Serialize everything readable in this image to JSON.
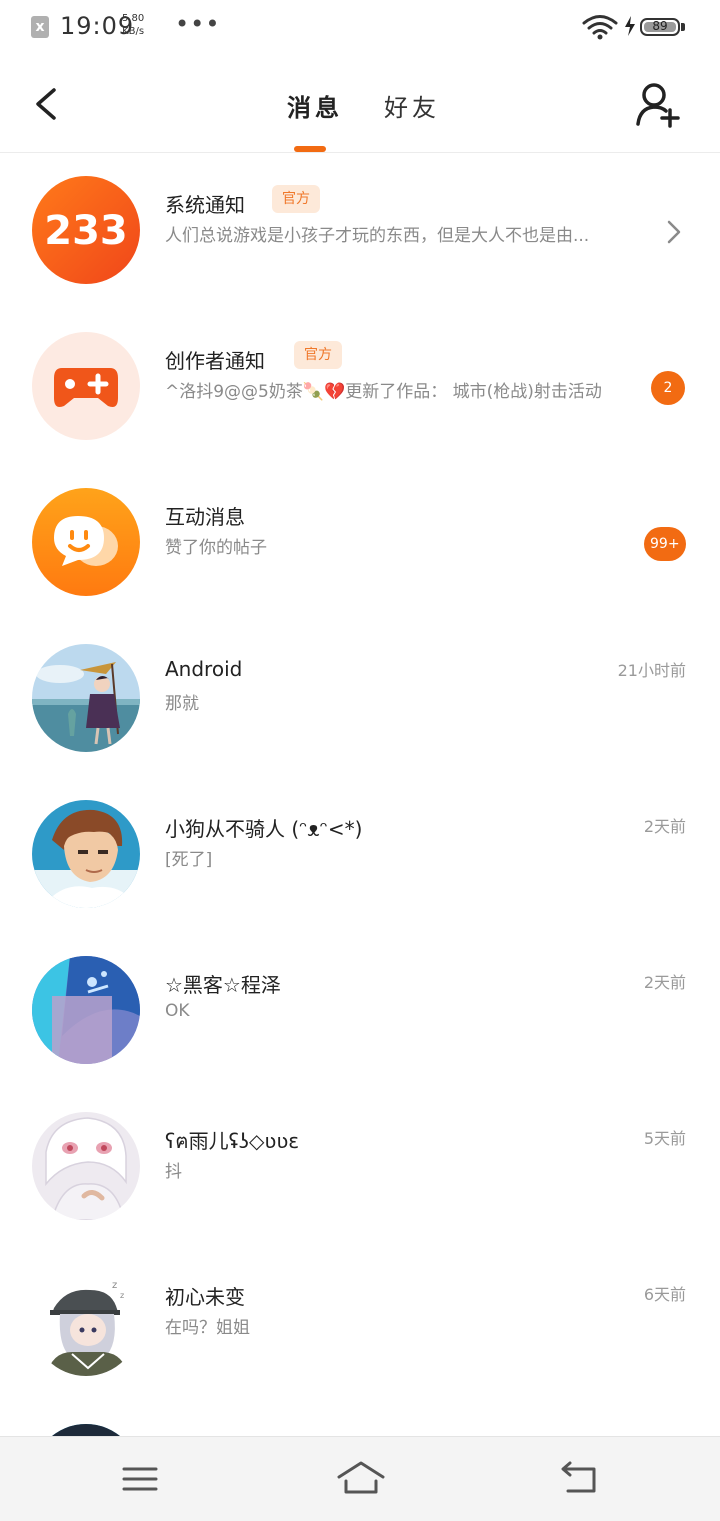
{
  "status_bar": {
    "sim_icon": "sim-missing-icon",
    "sim_glyph": "x",
    "time": "19:09",
    "speed_value": "5.80",
    "speed_unit": "KB/s",
    "more": "•••",
    "battery_level": "89"
  },
  "header": {
    "back_icon": "chevron-left-icon",
    "tabs": [
      {
        "label": "消息",
        "active": true
      },
      {
        "label": "好友",
        "active": false
      }
    ],
    "add_friend_icon": "add-user-icon",
    "accent_color": "#f26b12"
  },
  "messages": [
    {
      "name": "系统通知",
      "badge": "官方",
      "preview": "人们总说游戏是小孩子才玩的东西，但是大人不也是由...",
      "avatar_text": "233",
      "avatar_icon": "logo-233-icon",
      "trailing_icon": "chevron-right-icon"
    },
    {
      "name": "创作者通知",
      "badge": "官方",
      "preview": "^洛抖9@@5奶茶🍡💔更新了作品：  城市(枪战)射击活动",
      "avatar_icon": "gamepad-plus-icon",
      "unread": "2"
    },
    {
      "name": "互动消息",
      "preview": "赞了你的帖子",
      "avatar_icon": "chat-bubble-smile-icon",
      "unread": "99+"
    },
    {
      "name": "Android",
      "preview": "那就",
      "time": "21小时前",
      "avatar_icon": "user-avatar-icon"
    },
    {
      "name": "小狗从不骑人 (ᵔᴥᵔ<*)",
      "preview": "[死了]",
      "time": "2天前",
      "avatar_icon": "user-avatar-icon"
    },
    {
      "name": "☆黑客☆程泽",
      "preview": "OK",
      "time": "2天前",
      "avatar_icon": "user-avatar-icon"
    },
    {
      "name": "ʕฅ雨儿ʢʖ◇ʋʋɛ",
      "preview": "抖",
      "time": "5天前",
      "avatar_icon": "user-avatar-icon"
    },
    {
      "name": "初心未变",
      "preview": "在吗？姐姐",
      "time": "6天前",
      "avatar_icon": "user-avatar-icon"
    }
  ],
  "nav_bar": {
    "menu_icon": "menu-lines-icon",
    "home_icon": "home-icon",
    "back_icon": "back-arrow-icon"
  }
}
